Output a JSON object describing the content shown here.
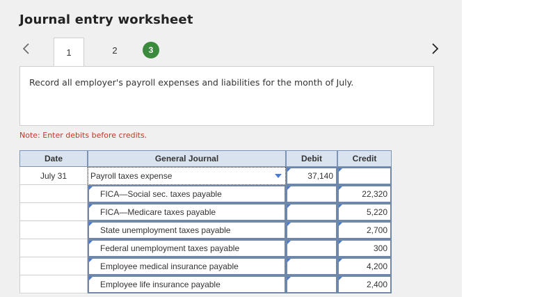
{
  "header": {
    "title": "Journal entry worksheet"
  },
  "steps": {
    "tab1": "1",
    "tab2": "2",
    "tab3": "3"
  },
  "instruction": "Record all employer's payroll expenses and liabilities for the month of July.",
  "note": "Note: Enter debits before credits.",
  "table": {
    "headers": {
      "date": "Date",
      "general_journal": "General Journal",
      "debit": "Debit",
      "credit": "Credit"
    },
    "rows": [
      {
        "date": "July 31",
        "account": "Payroll taxes expense",
        "debit": "37,140",
        "credit": ""
      },
      {
        "date": "",
        "account": "FICA—Social sec. taxes payable",
        "debit": "",
        "credit": "22,320"
      },
      {
        "date": "",
        "account": "FICA—Medicare taxes payable",
        "debit": "",
        "credit": "5,220"
      },
      {
        "date": "",
        "account": "State unemployment taxes payable",
        "debit": "",
        "credit": "2,700"
      },
      {
        "date": "",
        "account": "Federal unemployment taxes payable",
        "debit": "",
        "credit": "300"
      },
      {
        "date": "",
        "account": "Employee medical insurance payable",
        "debit": "",
        "credit": "4,200"
      },
      {
        "date": "",
        "account": "Employee life insurance payable",
        "debit": "",
        "credit": "2,400"
      }
    ]
  },
  "colors": {
    "active_step": "#3c8a3e",
    "note_text": "#c0392b",
    "header_bg": "#d9e3f0",
    "cell_border": "#6f88aa"
  }
}
